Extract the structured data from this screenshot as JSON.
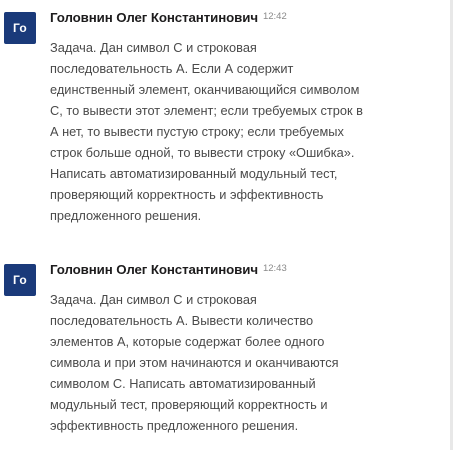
{
  "messages": [
    {
      "avatar_initials": "Го",
      "author": "Головнин Олег Константинович",
      "time": "12:42",
      "lines": [
        "Задача. Дан символ С и строковая",
        "последовательность А. Если А содержит",
        "единственный элемент, оканчивающийся символом",
        "С, то вывести этот элемент; если требуемых строк в",
        "А нет, то вывести пустую строку; если требуемых",
        "строк больше одной, то вывести строку «Ошибка».",
        "Написать автоматизированный модульный тест,",
        "проверяющий корректность и эффективность",
        "предложенного решения."
      ]
    },
    {
      "avatar_initials": "Го",
      "author": "Головнин Олег Константинович",
      "time": "12:43",
      "lines": [
        "Задача. Дан символ С и строковая",
        "последовательность А. Вывести количество",
        "элементов А, которые содержат более одного",
        "символа и при этом начинаются и оканчиваются",
        "символом С. Написать автоматизированный",
        "модульный тест, проверяющий корректность и",
        "эффективность предложенного решения."
      ]
    }
  ],
  "colors": {
    "avatar_bg": "#1a3a7a",
    "author_text": "#1d1c1d",
    "body_text": "#4a4a4a",
    "time_text": "#8a8a8a"
  }
}
